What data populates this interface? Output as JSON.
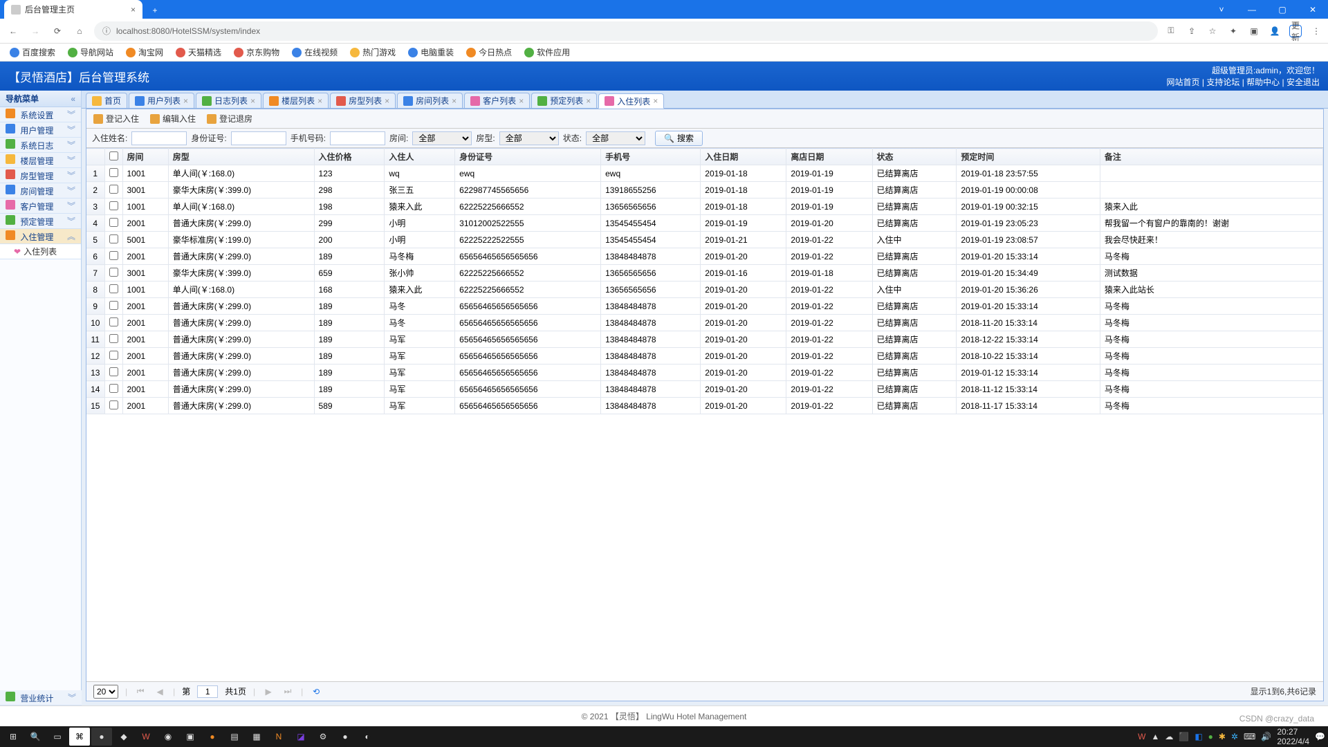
{
  "browser": {
    "tab_title": "后台管理主页",
    "url": "localhost:8080/HotelSSM/system/index",
    "update_label": "更新",
    "bookmarks": [
      "百度搜索",
      "导航网站",
      "淘宝网",
      "天猫精选",
      "京东购物",
      "在线视频",
      "热门游戏",
      "电脑重装",
      "今日热点",
      "软件应用"
    ]
  },
  "header": {
    "brand": "【灵悟酒店】后台管理系统",
    "admin_label": "超级管理员:admin，欢迎您！",
    "links": [
      "网站首页",
      "支持论坛",
      "帮助中心",
      "安全退出"
    ]
  },
  "sidebar": {
    "title": "导航菜单",
    "items": [
      {
        "label": "系统设置",
        "icon": "i-orange"
      },
      {
        "label": "用户管理",
        "icon": "i-blue"
      },
      {
        "label": "系统日志",
        "icon": "i-green"
      },
      {
        "label": "楼层管理",
        "icon": "i-yellow"
      },
      {
        "label": "房型管理",
        "icon": "i-red"
      },
      {
        "label": "房间管理",
        "icon": "i-blue"
      },
      {
        "label": "客户管理",
        "icon": "i-pink"
      },
      {
        "label": "预定管理",
        "icon": "i-green"
      }
    ],
    "active": {
      "label": "入住管理",
      "icon": "i-orange"
    },
    "sub": {
      "label": "入住列表"
    },
    "footer_item": {
      "label": "营业统计",
      "icon": "i-green"
    }
  },
  "tabs": [
    {
      "label": "首页",
      "icon": "i-yellow",
      "closable": false
    },
    {
      "label": "用户列表",
      "icon": "i-blue",
      "closable": true
    },
    {
      "label": "日志列表",
      "icon": "i-green",
      "closable": true
    },
    {
      "label": "楼层列表",
      "icon": "i-orange",
      "closable": true
    },
    {
      "label": "房型列表",
      "icon": "i-red",
      "closable": true
    },
    {
      "label": "房间列表",
      "icon": "i-blue",
      "closable": true
    },
    {
      "label": "客户列表",
      "icon": "i-pink",
      "closable": true
    },
    {
      "label": "预定列表",
      "icon": "i-green",
      "closable": true
    },
    {
      "label": "入住列表",
      "icon": "i-pink",
      "closable": true,
      "active": true
    }
  ],
  "toolbar": {
    "checkin": "登记入住",
    "edit": "编辑入住",
    "checkout": "登记退房"
  },
  "search": {
    "name_label": "入住姓名:",
    "name": "",
    "id_label": "身份证号:",
    "id": "",
    "phone_label": "手机号码:",
    "phone": "",
    "room_label": "房间:",
    "room": "全部",
    "type_label": "房型:",
    "type": "全部",
    "status_label": "状态:",
    "status": "全部",
    "button": "搜索"
  },
  "columns": [
    "房间",
    "房型",
    "入住价格",
    "入住人",
    "身份证号",
    "手机号",
    "入住日期",
    "离店日期",
    "状态",
    "预定时间",
    "备注"
  ],
  "rows": [
    {
      "room": "1001",
      "type": "单人间(￥:168.0)",
      "price": "123",
      "guest": "wq",
      "idcard": "ewq",
      "phone": "ewq",
      "in": "2019-01-18",
      "out": "2019-01-19",
      "status": "已结算离店",
      "time": "2019-01-18 23:57:55",
      "remark": ""
    },
    {
      "room": "3001",
      "type": "豪华大床房(￥:399.0)",
      "price": "298",
      "guest": "张三五",
      "idcard": "622987745565656",
      "phone": "13918655256",
      "in": "2019-01-18",
      "out": "2019-01-19",
      "status": "已结算离店",
      "time": "2019-01-19 00:00:08",
      "remark": ""
    },
    {
      "room": "1001",
      "type": "单人间(￥:168.0)",
      "price": "198",
      "guest": "猿来入此",
      "idcard": "62225225666552",
      "phone": "13656565656",
      "in": "2019-01-18",
      "out": "2019-01-19",
      "status": "已结算离店",
      "time": "2019-01-19 00:32:15",
      "remark": "猿来入此"
    },
    {
      "room": "2001",
      "type": "普通大床房(￥:299.0)",
      "price": "299",
      "guest": "小明",
      "idcard": "31012002522555",
      "phone": "13545455454",
      "in": "2019-01-19",
      "out": "2019-01-20",
      "status": "已结算离店",
      "time": "2019-01-19 23:05:23",
      "remark": "帮我留一个有窗户的靠南的！谢谢"
    },
    {
      "room": "5001",
      "type": "豪华标准房(￥:199.0)",
      "price": "200",
      "guest": "小明",
      "idcard": "62225222522555",
      "phone": "13545455454",
      "in": "2019-01-21",
      "out": "2019-01-22",
      "status": "入住中",
      "time": "2019-01-19 23:08:57",
      "remark": "我会尽快赶来！"
    },
    {
      "room": "2001",
      "type": "普通大床房(￥:299.0)",
      "price": "189",
      "guest": "马冬梅",
      "idcard": "65656465656565656",
      "phone": "13848484878",
      "in": "2019-01-20",
      "out": "2019-01-22",
      "status": "已结算离店",
      "time": "2019-01-20 15:33:14",
      "remark": "马冬梅"
    },
    {
      "room": "3001",
      "type": "豪华大床房(￥:399.0)",
      "price": "659",
      "guest": "张小帅",
      "idcard": "62225225666552",
      "phone": "13656565656",
      "in": "2019-01-16",
      "out": "2019-01-18",
      "status": "已结算离店",
      "time": "2019-01-20 15:34:49",
      "remark": "测试数据"
    },
    {
      "room": "1001",
      "type": "单人间(￥:168.0)",
      "price": "168",
      "guest": "猿来入此",
      "idcard": "62225225666552",
      "phone": "13656565656",
      "in": "2019-01-20",
      "out": "2019-01-22",
      "status": "入住中",
      "time": "2019-01-20 15:36:26",
      "remark": "猿来入此站长"
    },
    {
      "room": "2001",
      "type": "普通大床房(￥:299.0)",
      "price": "189",
      "guest": "马冬",
      "idcard": "65656465656565656",
      "phone": "13848484878",
      "in": "2019-01-20",
      "out": "2019-01-22",
      "status": "已结算离店",
      "time": "2019-01-20 15:33:14",
      "remark": "马冬梅"
    },
    {
      "room": "2001",
      "type": "普通大床房(￥:299.0)",
      "price": "189",
      "guest": "马冬",
      "idcard": "65656465656565656",
      "phone": "13848484878",
      "in": "2019-01-20",
      "out": "2019-01-22",
      "status": "已结算离店",
      "time": "2018-11-20 15:33:14",
      "remark": "马冬梅"
    },
    {
      "room": "2001",
      "type": "普通大床房(￥:299.0)",
      "price": "189",
      "guest": "马军",
      "idcard": "65656465656565656",
      "phone": "13848484878",
      "in": "2019-01-20",
      "out": "2019-01-22",
      "status": "已结算离店",
      "time": "2018-12-22 15:33:14",
      "remark": "马冬梅"
    },
    {
      "room": "2001",
      "type": "普通大床房(￥:299.0)",
      "price": "189",
      "guest": "马军",
      "idcard": "65656465656565656",
      "phone": "13848484878",
      "in": "2019-01-20",
      "out": "2019-01-22",
      "status": "已结算离店",
      "time": "2018-10-22 15:33:14",
      "remark": "马冬梅"
    },
    {
      "room": "2001",
      "type": "普通大床房(￥:299.0)",
      "price": "189",
      "guest": "马军",
      "idcard": "65656465656565656",
      "phone": "13848484878",
      "in": "2019-01-20",
      "out": "2019-01-22",
      "status": "已结算离店",
      "time": "2019-01-12 15:33:14",
      "remark": "马冬梅"
    },
    {
      "room": "2001",
      "type": "普通大床房(￥:299.0)",
      "price": "189",
      "guest": "马军",
      "idcard": "65656465656565656",
      "phone": "13848484878",
      "in": "2019-01-20",
      "out": "2019-01-22",
      "status": "已结算离店",
      "time": "2018-11-12 15:33:14",
      "remark": "马冬梅"
    },
    {
      "room": "2001",
      "type": "普通大床房(￥:299.0)",
      "price": "589",
      "guest": "马军",
      "idcard": "65656465656565656",
      "phone": "13848484878",
      "in": "2019-01-20",
      "out": "2019-01-22",
      "status": "已结算离店",
      "time": "2018-11-17 15:33:14",
      "remark": "马冬梅"
    }
  ],
  "pager": {
    "page_size": "20",
    "page_label_prefix": "第",
    "page": "1",
    "total_pages_label": "共1页",
    "info": "显示1到6,共6记录"
  },
  "footer": "© 2021 【灵悟】 LingWu Hotel Management",
  "tray": {
    "time": "20:27",
    "date": "2022/4/4"
  },
  "watermark": "CSDN @crazy_data"
}
